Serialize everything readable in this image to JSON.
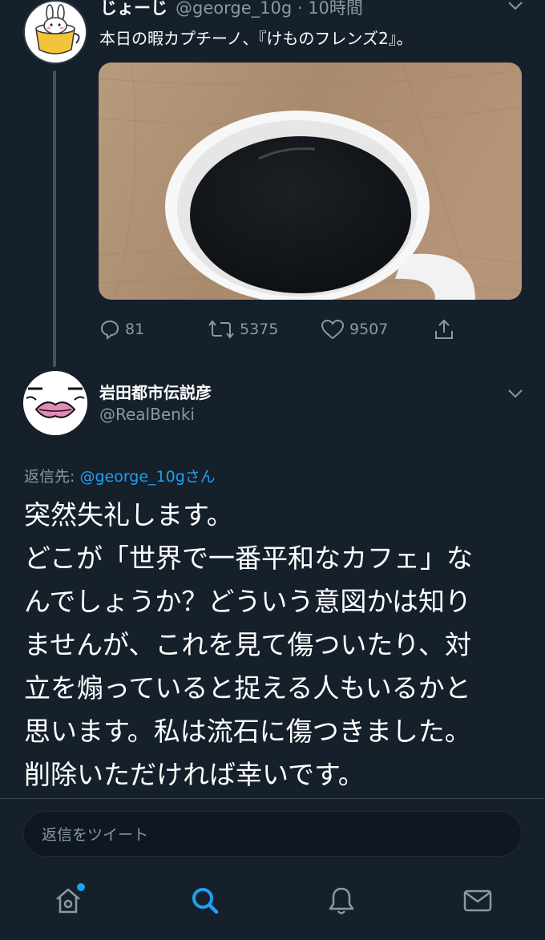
{
  "tweet1": {
    "name": "じょーじ",
    "handle": "@george_10g · 10時間",
    "text": "本日の暇カプチーノ、『けものフレンズ2』。",
    "media_alt": "white cup of black coffee on a wooden table",
    "stats": {
      "replies": "81",
      "retweets": "5375",
      "likes": "9507"
    }
  },
  "tweet2": {
    "name": "岩田都市伝説彦",
    "handle": "@RealBenki",
    "reply_to_label": "返信先: ",
    "reply_to_mention": "@george_10gさん",
    "body_lines": [
      "突然失礼します。",
      "どこが「世界で一番平和なカフェ」な",
      "んでしょうか？どういう意図かは知り",
      "ませんが、これを見て傷ついたり、対",
      "立を煽っていると捉える人もいるかと",
      "思います。私は流石に傷つきました。",
      "削除いただければ幸いです。"
    ]
  },
  "reply_bar": {
    "placeholder": "返信をツイート"
  },
  "nav": {
    "items": [
      "home-icon",
      "search-icon",
      "notifications-icon",
      "messages-icon"
    ],
    "active": "search-icon"
  },
  "colors": {
    "background": "#15202b",
    "accent": "#1da1f2",
    "secondary_text": "#8899a6"
  }
}
